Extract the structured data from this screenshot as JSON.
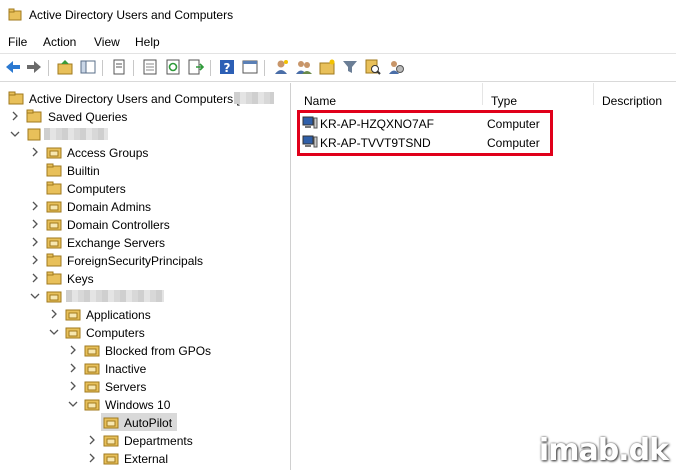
{
  "window": {
    "title": "Active Directory Users and Computers"
  },
  "menu": [
    "File",
    "Action",
    "View",
    "Help"
  ],
  "toolbar": {
    "buttons": [
      "back-icon",
      "forward-icon",
      "up-folder-icon",
      "show-tree-icon",
      "copy-icon",
      "properties-icon",
      "refresh-icon",
      "export-icon",
      "help-icon",
      "console-icon",
      "new-user-icon",
      "new-group-icon",
      "new-ou-icon",
      "filter-icon",
      "find-icon",
      "delegate-icon"
    ]
  },
  "tree": {
    "root": "Active Directory Users and Computers [",
    "saved_queries": "Saved Queries",
    "items": [
      "Access Groups",
      "Builtin",
      "Computers",
      "Domain Admins",
      "Domain Controllers",
      "Exchange Servers",
      "ForeignSecurityPrincipals",
      "Keys"
    ],
    "sub_items": [
      "Applications",
      "Computers"
    ],
    "computer_children": [
      "Blocked from GPOs",
      "Inactive",
      "Servers",
      "Windows 10"
    ],
    "win10_children": [
      "AutoPilot",
      "Departments",
      "External"
    ]
  },
  "list": {
    "columns": [
      "Name",
      "Type",
      "Description"
    ],
    "rows": [
      {
        "name": "KR-AP-HZQXNO7AF",
        "type": "Computer"
      },
      {
        "name": "KR-AP-TVVT9TSND",
        "type": "Computer"
      }
    ]
  },
  "watermark": "imab.dk",
  "colors": {
    "highlight_border": "#e0001a",
    "selection": "#d9d9d9",
    "folder": "#e8c05a"
  }
}
